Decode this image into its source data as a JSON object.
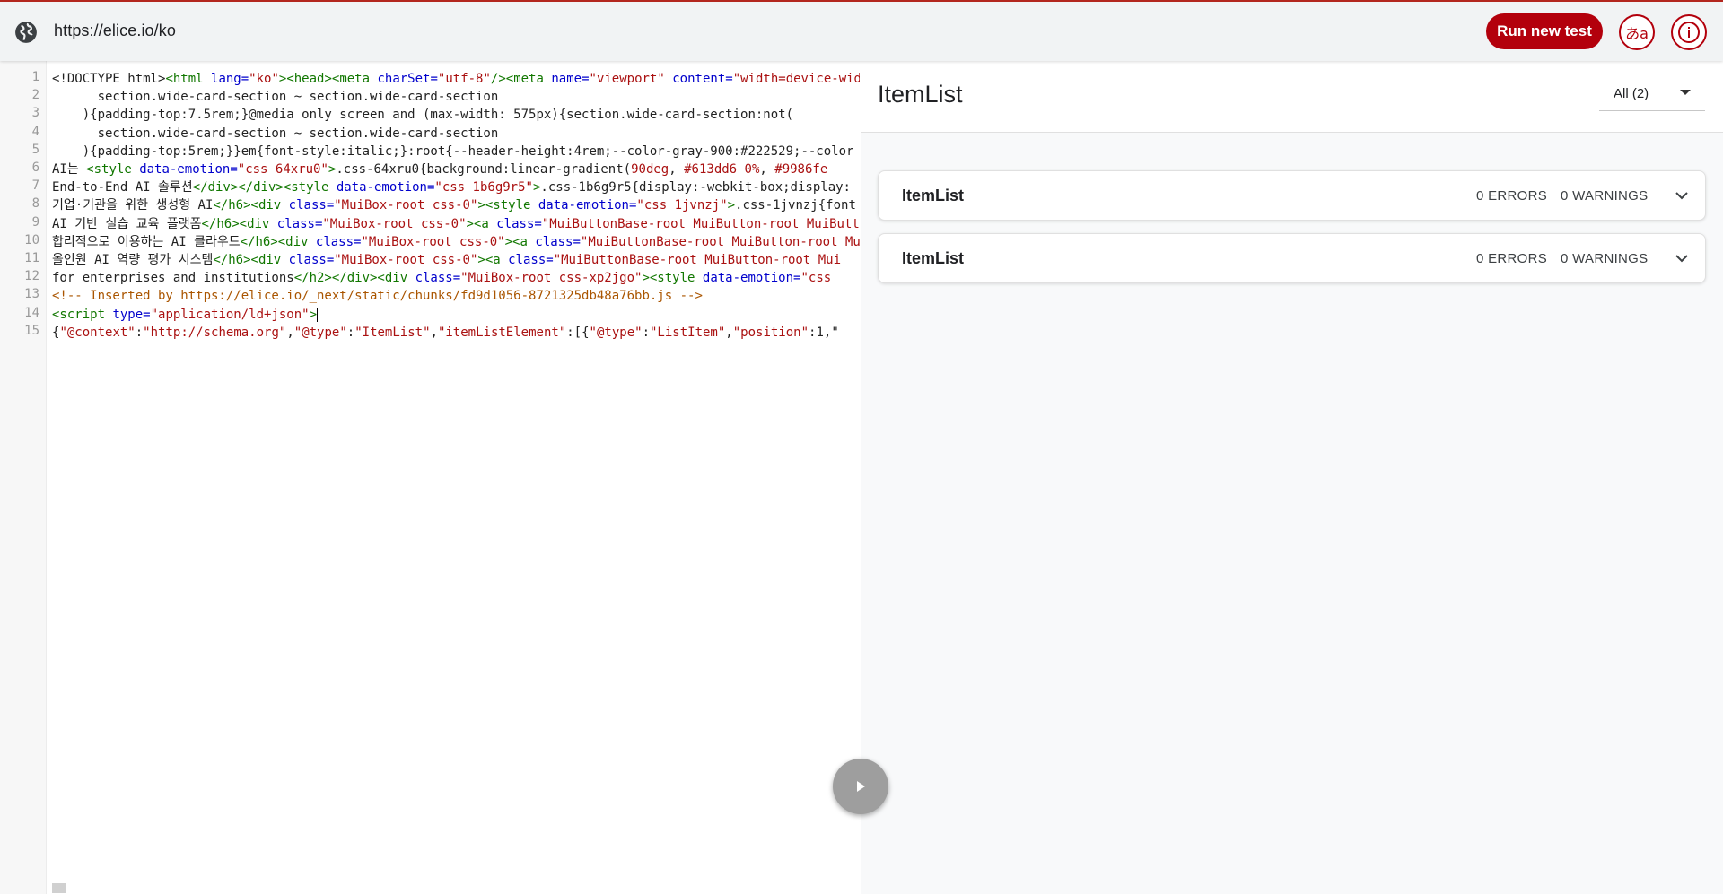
{
  "topbar": {
    "url": "https://elice.io/ko",
    "run_label": "Run new test",
    "lang_label": "あa",
    "info_label": "i"
  },
  "editor": {
    "line_numbers": [
      "1",
      "2",
      "3",
      "4",
      "5",
      "6",
      "7",
      "8",
      "9",
      "10",
      "11",
      "12",
      "13",
      "14",
      "15"
    ],
    "lines": [
      [
        {
          "c": "",
          "t": "<!DOCTYPE html>"
        },
        {
          "c": "tag",
          "t": "<html "
        },
        {
          "c": "attr",
          "t": "lang="
        },
        {
          "c": "str",
          "t": "\"ko\""
        },
        {
          "c": "tag",
          "t": "><head><meta "
        },
        {
          "c": "attr",
          "t": "charSet="
        },
        {
          "c": "str",
          "t": "\"utf-8\""
        },
        {
          "c": "tag",
          "t": "/><meta "
        },
        {
          "c": "attr",
          "t": "name="
        },
        {
          "c": "str",
          "t": "\"viewport\""
        },
        {
          "c": "",
          "t": " "
        },
        {
          "c": "attr",
          "t": "content="
        },
        {
          "c": "str",
          "t": "\"width=device-width"
        }
      ],
      [
        {
          "c": "",
          "t": "      section.wide-card-section ~ section.wide-card-section"
        }
      ],
      [
        {
          "c": "",
          "t": "    ){padding-top:7.5rem;}@media only screen and (max-width: 575px){section.wide-card-section:not("
        }
      ],
      [
        {
          "c": "",
          "t": "      section.wide-card-section ~ section.wide-card-section"
        }
      ],
      [
        {
          "c": "",
          "t": "    ){padding-top:5rem;}}em{font-style:italic;}:root{--header-height:4rem;--color-gray-900:#222529;--color"
        }
      ],
      [
        {
          "c": "",
          "t": "AI는 "
        },
        {
          "c": "tag",
          "t": "<style "
        },
        {
          "c": "attr",
          "t": "data-emotion="
        },
        {
          "c": "str",
          "t": "\"css 64xru0\""
        },
        {
          "c": "tag",
          "t": ">"
        },
        {
          "c": "",
          "t": ".css-64xru0{background:linear-gradient("
        },
        {
          "c": "str",
          "t": "90deg"
        },
        {
          "c": "",
          "t": ", "
        },
        {
          "c": "str",
          "t": "#613dd6 0%"
        },
        {
          "c": "",
          "t": ", "
        },
        {
          "c": "str",
          "t": "#9986fe"
        }
      ],
      [
        {
          "c": "",
          "t": "End-to-End AI 솔루션"
        },
        {
          "c": "tag",
          "t": "</div></div><style "
        },
        {
          "c": "attr",
          "t": "data-emotion="
        },
        {
          "c": "str",
          "t": "\"css 1b6g9r5\""
        },
        {
          "c": "tag",
          "t": ">"
        },
        {
          "c": "",
          "t": ".css-1b6g9r5{display:-webkit-box;display:"
        }
      ],
      [
        {
          "c": "",
          "t": "기업·기관을 위한 생성형 AI"
        },
        {
          "c": "tag",
          "t": "</h6><div "
        },
        {
          "c": "attr",
          "t": "class="
        },
        {
          "c": "str",
          "t": "\"MuiBox-root css-0\""
        },
        {
          "c": "tag",
          "t": "><style "
        },
        {
          "c": "attr",
          "t": "data-emotion="
        },
        {
          "c": "str",
          "t": "\"css 1jvnzj\""
        },
        {
          "c": "tag",
          "t": ">"
        },
        {
          "c": "",
          "t": ".css-1jvnzj{font"
        }
      ],
      [
        {
          "c": "",
          "t": "AI 기반 실습 교육 플랫폼"
        },
        {
          "c": "tag",
          "t": "</h6><div "
        },
        {
          "c": "attr",
          "t": "class="
        },
        {
          "c": "str",
          "t": "\"MuiBox-root css-0\""
        },
        {
          "c": "tag",
          "t": "><a "
        },
        {
          "c": "attr",
          "t": "class="
        },
        {
          "c": "str",
          "t": "\"MuiButtonBase-root MuiButton-root MuiButton"
        }
      ],
      [
        {
          "c": "",
          "t": "합리적으로 이용하는 AI 클라우드"
        },
        {
          "c": "tag",
          "t": "</h6><div "
        },
        {
          "c": "attr",
          "t": "class="
        },
        {
          "c": "str",
          "t": "\"MuiBox-root css-0\""
        },
        {
          "c": "tag",
          "t": "><a "
        },
        {
          "c": "attr",
          "t": "class="
        },
        {
          "c": "str",
          "t": "\"MuiButtonBase-root MuiButton-root Mui"
        }
      ],
      [
        {
          "c": "",
          "t": "올인원 AI 역량 평가 시스템"
        },
        {
          "c": "tag",
          "t": "</h6><div "
        },
        {
          "c": "attr",
          "t": "class="
        },
        {
          "c": "str",
          "t": "\"MuiBox-root css-0\""
        },
        {
          "c": "tag",
          "t": "><a "
        },
        {
          "c": "attr",
          "t": "class="
        },
        {
          "c": "str",
          "t": "\"MuiButtonBase-root MuiButton-root Mui"
        }
      ],
      [
        {
          "c": "",
          "t": "for enterprises and institutions"
        },
        {
          "c": "tag",
          "t": "</h2></div><div "
        },
        {
          "c": "attr",
          "t": "class="
        },
        {
          "c": "str",
          "t": "\"MuiBox-root css-xp2jgo\""
        },
        {
          "c": "tag",
          "t": "><style "
        },
        {
          "c": "attr",
          "t": "data-emotion="
        },
        {
          "c": "str",
          "t": "\"css"
        }
      ],
      [
        {
          "c": "cmt",
          "t": "<!-- Inserted by https://elice.io/_next/static/chunks/fd9d1056-8721325db48a76bb.js -->"
        }
      ],
      [
        {
          "c": "tag",
          "t": "<script "
        },
        {
          "c": "attr",
          "t": "type="
        },
        {
          "c": "str",
          "t": "\"application/ld+json\""
        },
        {
          "c": "tag",
          "t": ">"
        }
      ],
      [
        {
          "c": "",
          "t": "{"
        },
        {
          "c": "str",
          "t": "\"@context\""
        },
        {
          "c": "",
          "t": ":"
        },
        {
          "c": "str",
          "t": "\"http://schema.org\""
        },
        {
          "c": "",
          "t": ","
        },
        {
          "c": "str",
          "t": "\"@type\""
        },
        {
          "c": "",
          "t": ":"
        },
        {
          "c": "str",
          "t": "\"ItemList\""
        },
        {
          "c": "",
          "t": ","
        },
        {
          "c": "str",
          "t": "\"itemListElement\""
        },
        {
          "c": "",
          "t": ":[{"
        },
        {
          "c": "str",
          "t": "\"@type\""
        },
        {
          "c": "",
          "t": ":"
        },
        {
          "c": "str",
          "t": "\"ListItem\""
        },
        {
          "c": "",
          "t": ","
        },
        {
          "c": "str",
          "t": "\"position\""
        },
        {
          "c": "",
          "t": ":1,\""
        }
      ]
    ]
  },
  "panel": {
    "title": "ItemList",
    "filter_label": "All (2)",
    "results": [
      {
        "title": "ItemList",
        "errors": "0 ERRORS",
        "warnings": "0 WARNINGS"
      },
      {
        "title": "ItemList",
        "errors": "0 ERRORS",
        "warnings": "0 WARNINGS"
      }
    ]
  },
  "icons": {
    "globe": "globe-icon",
    "play": "play-icon",
    "chevron": "chevron-down-icon",
    "caret": "caret-down-icon",
    "info": "info-icon",
    "translate": "translate-icon"
  },
  "colors": {
    "accent": "#b3000c",
    "play_button": "#9e9e9e"
  }
}
